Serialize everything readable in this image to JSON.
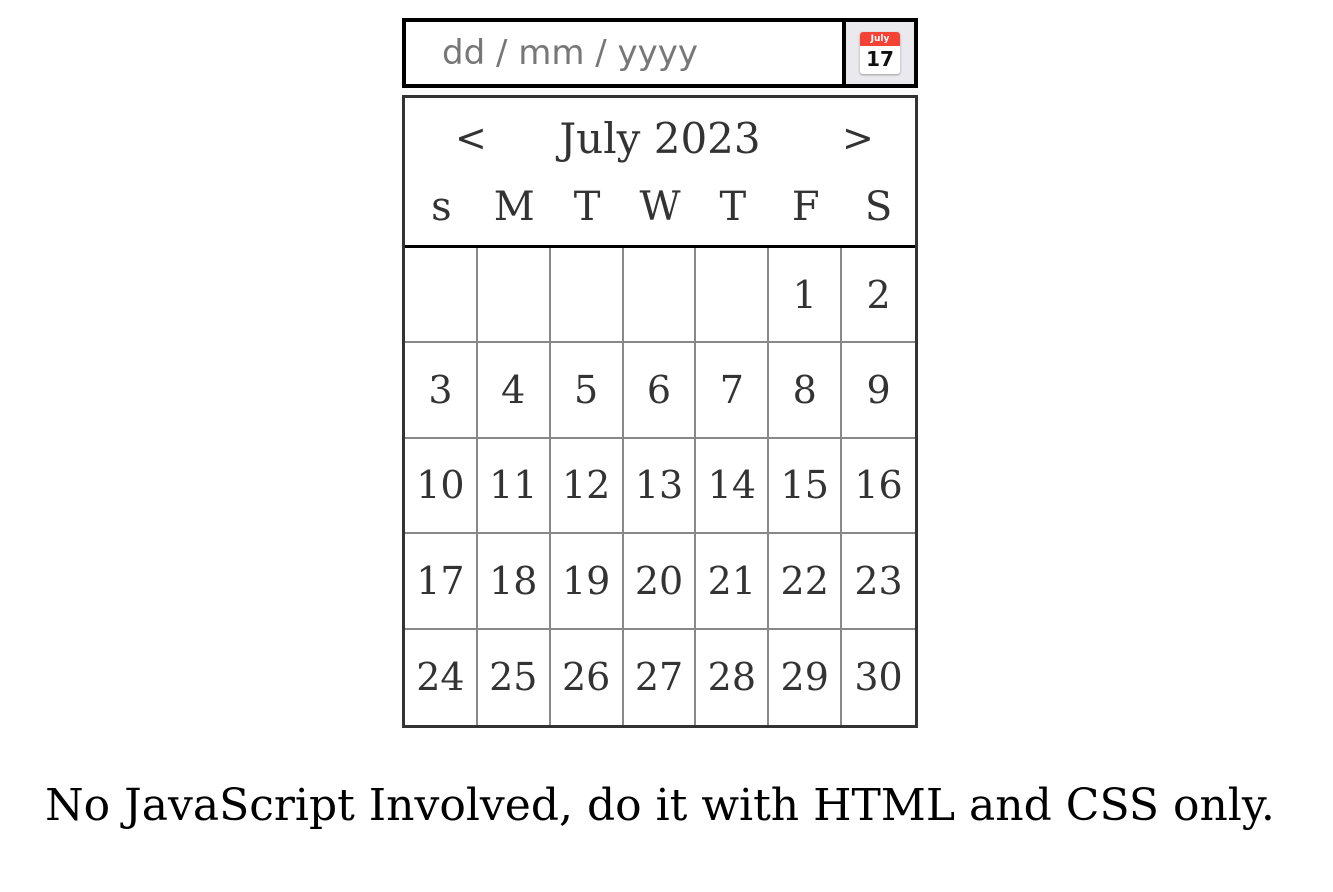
{
  "input": {
    "placeholder": "dd / mm / yyyy",
    "icon": "calendar-icon",
    "icon_month": "July",
    "icon_day": "17"
  },
  "calendar": {
    "prev": "<",
    "next": ">",
    "title": "July 2023",
    "weekdays": [
      "s",
      "M",
      "T",
      "W",
      "T",
      "F",
      "S"
    ],
    "days": [
      "",
      "",
      "",
      "",
      "",
      "1",
      "2",
      "3",
      "4",
      "5",
      "6",
      "7",
      "8",
      "9",
      "10",
      "11",
      "12",
      "13",
      "14",
      "15",
      "16",
      "17",
      "18",
      "19",
      "20",
      "21",
      "22",
      "23",
      "24",
      "25",
      "26",
      "27",
      "28",
      "29",
      "30"
    ]
  },
  "footer": "No JavaScript Involved, do it with HTML and CSS only."
}
